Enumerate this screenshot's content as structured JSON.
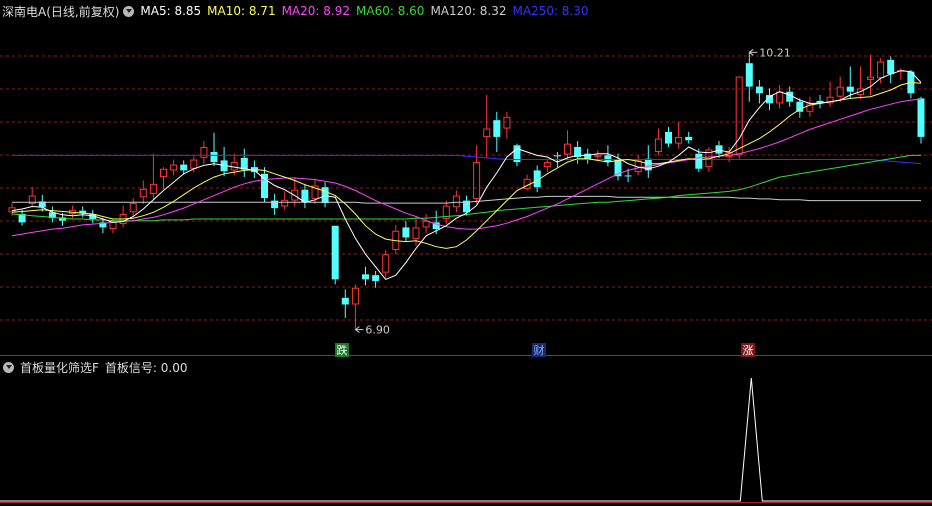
{
  "main_panel": {
    "title": "深南电A(日线,前复权)",
    "indicators": [
      {
        "label": "MA5: 8.85",
        "color": "#ffffff"
      },
      {
        "label": "MA10: 8.71",
        "color": "#ffff55"
      },
      {
        "label": "MA20: 8.92",
        "color": "#ff44ff"
      },
      {
        "label": "MA60: 8.60",
        "color": "#33dd33"
      },
      {
        "label": "MA120: 8.32",
        "color": "#cccccc"
      },
      {
        "label": "MA250: 8.30",
        "color": "#3333ff"
      }
    ],
    "high_label": "10.21",
    "low_label": "6.90",
    "markers": [
      {
        "text": "跌",
        "bg": "#1a7a2a",
        "fg": "#ffffff"
      },
      {
        "text": "财",
        "bg": "#1a2a6a",
        "fg": "#88aaff"
      },
      {
        "text": "涨",
        "bg": "#7a1a1a",
        "fg": "#ffffff"
      }
    ]
  },
  "sub_panel": {
    "title": "首板量化筛选F",
    "signal_label": "首板信号: 0.00"
  },
  "colors": {
    "up": "#ff3333",
    "down": "#54ffff",
    "grid": "#8a1e1e",
    "ma5": "#ffffff",
    "ma10": "#ffff55",
    "ma20": "#ff44ff",
    "ma60": "#33dd33",
    "ma120": "#cccccc",
    "ma250": "#3333ff"
  },
  "chart_data": {
    "type": "candlestick",
    "high": 10.21,
    "low": 6.9,
    "candles": [
      [
        8.3,
        8.36,
        8.26,
        8.41
      ],
      [
        8.28,
        8.18,
        8.14,
        8.33
      ],
      [
        8.4,
        8.5,
        8.36,
        8.6
      ],
      [
        8.43,
        8.36,
        8.31,
        8.51
      ],
      [
        8.3,
        8.23,
        8.18,
        8.37
      ],
      [
        8.24,
        8.2,
        8.14,
        8.29
      ],
      [
        8.28,
        8.33,
        8.23,
        8.38
      ],
      [
        8.32,
        8.29,
        8.24,
        8.37
      ],
      [
        8.28,
        8.22,
        8.17,
        8.33
      ],
      [
        8.18,
        8.12,
        8.05,
        8.23
      ],
      [
        8.1,
        8.19,
        8.05,
        8.22
      ],
      [
        8.16,
        8.28,
        8.12,
        8.38
      ],
      [
        8.3,
        8.41,
        8.25,
        8.47
      ],
      [
        8.48,
        8.58,
        8.4,
        8.68
      ],
      [
        8.52,
        8.64,
        8.46,
        9.0
      ],
      [
        8.72,
        8.82,
        8.58,
        8.84
      ],
      [
        8.8,
        8.87,
        8.74,
        8.93
      ],
      [
        8.87,
        8.8,
        8.75,
        8.92
      ],
      [
        8.82,
        8.93,
        8.78,
        8.97
      ],
      [
        8.95,
        9.08,
        8.88,
        9.15
      ],
      [
        9.02,
        8.9,
        8.85,
        9.25
      ],
      [
        8.92,
        8.79,
        8.73,
        9.08
      ],
      [
        8.8,
        8.9,
        8.74,
        9.0
      ],
      [
        8.95,
        8.81,
        8.72,
        9.06
      ],
      [
        8.84,
        8.78,
        8.71,
        8.92
      ],
      [
        8.76,
        8.47,
        8.42,
        8.84
      ],
      [
        8.44,
        8.35,
        8.27,
        8.52
      ],
      [
        8.37,
        8.45,
        8.33,
        8.55
      ],
      [
        8.44,
        8.57,
        8.37,
        8.72
      ],
      [
        8.57,
        8.42,
        8.35,
        8.64
      ],
      [
        8.46,
        8.62,
        8.4,
        8.7
      ],
      [
        8.6,
        8.41,
        8.36,
        8.66
      ],
      [
        8.14,
        7.5,
        7.44,
        8.14
      ],
      [
        7.28,
        7.2,
        7.04,
        7.38
      ],
      [
        7.2,
        7.4,
        6.9,
        7.44
      ],
      [
        7.56,
        7.5,
        7.43,
        7.65
      ],
      [
        7.55,
        7.48,
        7.4,
        7.6
      ],
      [
        7.58,
        7.8,
        7.52,
        7.85
      ],
      [
        7.85,
        8.08,
        7.8,
        8.15
      ],
      [
        8.12,
        8.0,
        7.95,
        8.2
      ],
      [
        7.98,
        8.12,
        7.9,
        8.24
      ],
      [
        8.12,
        8.2,
        8.05,
        8.28
      ],
      [
        8.18,
        8.1,
        8.04,
        8.32
      ],
      [
        8.22,
        8.38,
        8.16,
        8.44
      ],
      [
        8.36,
        8.5,
        8.3,
        8.56
      ],
      [
        8.44,
        8.3,
        8.26,
        8.5
      ],
      [
        8.46,
        8.9,
        8.4,
        9.1
      ],
      [
        9.2,
        9.3,
        8.95,
        9.7
      ],
      [
        9.4,
        9.2,
        9.02,
        9.5
      ],
      [
        9.3,
        9.44,
        9.18,
        9.5
      ],
      [
        9.1,
        8.9,
        8.85,
        9.12
      ],
      [
        8.58,
        8.7,
        8.56,
        8.75
      ],
      [
        8.8,
        8.6,
        8.54,
        8.86
      ],
      [
        8.84,
        8.9,
        8.78,
        8.94
      ],
      [
        8.98,
        8.97,
        8.84,
        9.02
      ],
      [
        8.99,
        9.12,
        8.94,
        9.28
      ],
      [
        9.08,
        8.96,
        8.88,
        9.15
      ],
      [
        9.0,
        8.94,
        8.88,
        9.06
      ],
      [
        8.98,
        8.98,
        8.92,
        9.04
      ],
      [
        8.98,
        8.9,
        8.85,
        9.1
      ],
      [
        8.93,
        8.73,
        8.68,
        9.0
      ],
      [
        8.74,
        8.73,
        8.66,
        8.82
      ],
      [
        8.78,
        8.92,
        8.74,
        8.98
      ],
      [
        8.94,
        8.8,
        8.71,
        9.1
      ],
      [
        9.02,
        9.18,
        8.98,
        9.3
      ],
      [
        9.26,
        9.12,
        9.08,
        9.32
      ],
      [
        9.12,
        9.2,
        9.06,
        9.38
      ],
      [
        9.2,
        9.16,
        9.12,
        9.26
      ],
      [
        9.0,
        8.82,
        8.78,
        9.06
      ],
      [
        8.84,
        9.05,
        8.78,
        9.08
      ],
      [
        9.1,
        9.0,
        8.95,
        9.15
      ],
      [
        8.96,
        9.02,
        8.9,
        9.08
      ],
      [
        8.98,
        9.92,
        8.94,
        9.92
      ],
      [
        10.08,
        9.8,
        9.62,
        10.21
      ],
      [
        9.8,
        9.72,
        9.6,
        9.88
      ],
      [
        9.7,
        9.6,
        9.52,
        9.78
      ],
      [
        9.6,
        9.74,
        9.54,
        9.82
      ],
      [
        9.74,
        9.62,
        9.56,
        9.8
      ],
      [
        9.62,
        9.5,
        9.43,
        9.66
      ],
      [
        9.5,
        9.6,
        9.44,
        9.68
      ],
      [
        9.63,
        9.6,
        9.54,
        9.7
      ],
      [
        9.6,
        9.68,
        9.56,
        9.86
      ],
      [
        9.68,
        9.8,
        9.62,
        9.92
      ],
      [
        9.8,
        9.74,
        9.66,
        10.04
      ],
      [
        9.7,
        9.78,
        9.65,
        10.04
      ],
      [
        9.88,
        9.92,
        9.7,
        10.18
      ],
      [
        9.9,
        10.1,
        9.84,
        10.14
      ],
      [
        10.12,
        9.95,
        9.84,
        10.16
      ],
      [
        9.98,
        10.0,
        9.88,
        10.02
      ],
      [
        9.98,
        9.72,
        9.66,
        10.0
      ],
      [
        9.66,
        9.2,
        9.12,
        9.68
      ]
    ],
    "ma": {
      "ma5": [
        8.32,
        8.34,
        8.37,
        8.36,
        8.3,
        8.27,
        8.26,
        8.27,
        8.26,
        8.22,
        8.18,
        8.19,
        8.25,
        8.34,
        8.45,
        8.56,
        8.66,
        8.76,
        8.82,
        8.86,
        8.88,
        8.86,
        8.84,
        8.82,
        8.8,
        8.7,
        8.62,
        8.57,
        8.5,
        8.42,
        8.45,
        8.5,
        8.48,
        8.22,
        7.99,
        7.8,
        7.65,
        7.5,
        7.55,
        7.7,
        7.87,
        8.02,
        8.08,
        8.14,
        8.23,
        8.29,
        8.38,
        8.6,
        8.77,
        8.96,
        9.06,
        9.02,
        8.98,
        8.96,
        8.9,
        8.95,
        8.98,
        8.98,
        9.0,
        9.0,
        8.95,
        8.88,
        8.84,
        8.82,
        8.85,
        8.9,
        8.98,
        9.08,
        9.02,
        9.01,
        9.04,
        9.02,
        9.18,
        9.4,
        9.55,
        9.68,
        9.74,
        9.7,
        9.64,
        9.6,
        9.6,
        9.62,
        9.64,
        9.7,
        9.74,
        9.8,
        9.9,
        9.95,
        9.99,
        9.98,
        9.85
      ],
      "ma10": [
        8.3,
        8.31,
        8.32,
        8.33,
        8.32,
        8.31,
        8.3,
        8.29,
        8.28,
        8.25,
        8.22,
        8.22,
        8.23,
        8.26,
        8.3,
        8.36,
        8.43,
        8.51,
        8.59,
        8.66,
        8.72,
        8.76,
        8.78,
        8.8,
        8.81,
        8.8,
        8.76,
        8.72,
        8.68,
        8.63,
        8.59,
        8.55,
        8.5,
        8.4,
        8.28,
        8.14,
        8.04,
        7.98,
        7.96,
        7.95,
        7.96,
        7.93,
        7.89,
        7.87,
        7.89,
        7.97,
        8.08,
        8.2,
        8.32,
        8.44,
        8.56,
        8.62,
        8.68,
        8.76,
        8.83,
        8.9,
        8.94,
        8.94,
        8.92,
        8.9,
        8.92,
        8.93,
        8.91,
        8.88,
        8.88,
        8.9,
        8.92,
        8.94,
        8.93,
        8.94,
        8.97,
        9.0,
        9.06,
        9.12,
        9.18,
        9.26,
        9.35,
        9.45,
        9.53,
        9.58,
        9.6,
        9.62,
        9.64,
        9.66,
        9.67,
        9.68,
        9.72,
        9.76,
        9.82,
        9.85,
        9.84
      ],
      "ma20": [
        8.02,
        8.04,
        8.06,
        8.08,
        8.1,
        8.11,
        8.13,
        8.15,
        8.16,
        8.17,
        8.18,
        8.19,
        8.2,
        8.22,
        8.24,
        8.27,
        8.31,
        8.35,
        8.4,
        8.45,
        8.5,
        8.55,
        8.6,
        8.64,
        8.67,
        8.69,
        8.7,
        8.71,
        8.71,
        8.7,
        8.69,
        8.67,
        8.65,
        8.61,
        8.56,
        8.5,
        8.44,
        8.39,
        8.34,
        8.29,
        8.25,
        8.2,
        8.16,
        8.13,
        8.11,
        8.1,
        8.1,
        8.12,
        8.14,
        8.17,
        8.21,
        8.25,
        8.3,
        8.35,
        8.4,
        8.46,
        8.52,
        8.58,
        8.64,
        8.7,
        8.76,
        8.8,
        8.83,
        8.85,
        8.87,
        8.89,
        8.91,
        8.93,
        8.95,
        8.96,
        8.97,
        8.98,
        9.0,
        9.03,
        9.06,
        9.1,
        9.14,
        9.19,
        9.24,
        9.29,
        9.33,
        9.37,
        9.41,
        9.45,
        9.49,
        9.53,
        9.56,
        9.59,
        9.62,
        9.64,
        9.65
      ],
      "ma60": [
        8.28,
        8.27,
        8.26,
        8.25,
        8.24,
        8.23,
        8.22,
        8.22,
        8.21,
        8.21,
        8.2,
        8.2,
        8.2,
        8.2,
        8.2,
        8.21,
        8.21,
        8.21,
        8.22,
        8.22,
        8.22,
        8.22,
        8.22,
        8.22,
        8.22,
        8.22,
        8.22,
        8.22,
        8.22,
        8.22,
        8.22,
        8.22,
        8.22,
        8.22,
        8.22,
        8.22,
        8.22,
        8.22,
        8.22,
        8.22,
        8.23,
        8.23,
        8.24,
        8.25,
        8.26,
        8.27,
        8.29,
        8.3,
        8.32,
        8.33,
        8.34,
        8.35,
        8.36,
        8.37,
        8.38,
        8.39,
        8.4,
        8.41,
        8.42,
        8.42,
        8.43,
        8.44,
        8.45,
        8.46,
        8.47,
        8.48,
        8.5,
        8.51,
        8.52,
        8.53,
        8.54,
        8.55,
        8.57,
        8.6,
        8.64,
        8.68,
        8.72,
        8.74,
        8.76,
        8.78,
        8.8,
        8.82,
        8.84,
        8.86,
        8.88,
        8.9,
        8.92,
        8.94,
        8.96,
        8.98,
        8.98
      ],
      "ma120": [
        8.42,
        8.42,
        8.42,
        8.42,
        8.42,
        8.42,
        8.42,
        8.42,
        8.42,
        8.42,
        8.42,
        8.42,
        8.42,
        8.42,
        8.42,
        8.42,
        8.42,
        8.42,
        8.42,
        8.42,
        8.42,
        8.42,
        8.42,
        8.42,
        8.42,
        8.42,
        8.42,
        8.42,
        8.42,
        8.42,
        8.42,
        8.42,
        8.42,
        8.42,
        8.42,
        8.41,
        8.41,
        8.41,
        8.41,
        8.41,
        8.41,
        8.41,
        8.41,
        8.41,
        8.42,
        8.42,
        8.43,
        8.44,
        8.45,
        8.46,
        8.47,
        8.48,
        8.48,
        8.49,
        8.49,
        8.49,
        8.49,
        8.49,
        8.49,
        8.49,
        8.48,
        8.48,
        8.48,
        8.48,
        8.48,
        8.48,
        8.48,
        8.48,
        8.48,
        8.48,
        8.48,
        8.48,
        8.47,
        8.47,
        8.46,
        8.46,
        8.45,
        8.45,
        8.45,
        8.44,
        8.44,
        8.44,
        8.44,
        8.44,
        8.44,
        8.44,
        8.44,
        8.44,
        8.44,
        8.44,
        8.44
      ],
      "ma250": [
        8.98,
        8.98,
        8.98,
        8.98,
        8.98,
        8.98,
        8.98,
        8.98,
        8.98,
        8.98,
        8.98,
        8.98,
        8.98,
        8.98,
        8.98,
        8.98,
        8.98,
        8.98,
        8.98,
        8.98,
        8.98,
        8.98,
        8.98,
        8.98,
        8.98,
        8.98,
        8.98,
        8.98,
        8.98,
        8.98,
        8.98,
        8.98,
        8.98,
        8.98,
        8.98,
        8.98,
        8.98,
        8.98,
        8.98,
        8.98,
        8.98,
        8.98,
        8.98,
        8.98,
        8.98,
        8.97,
        8.96,
        8.95,
        8.94,
        8.93,
        8.93,
        8.93,
        8.93,
        8.93,
        8.93,
        8.93,
        8.93,
        8.93,
        8.93,
        8.93,
        8.93,
        8.93,
        8.93,
        8.93,
        8.93,
        8.93,
        8.93,
        8.93,
        8.93,
        8.93,
        8.93,
        8.93,
        8.93,
        8.93,
        8.93,
        8.93,
        8.93,
        8.93,
        8.93,
        8.93,
        8.93,
        8.93,
        8.93,
        8.93,
        8.93,
        8.93,
        8.92,
        8.91,
        8.9,
        8.89,
        8.88
      ]
    },
    "signal": {
      "candle_index": 73,
      "value": 1
    }
  }
}
